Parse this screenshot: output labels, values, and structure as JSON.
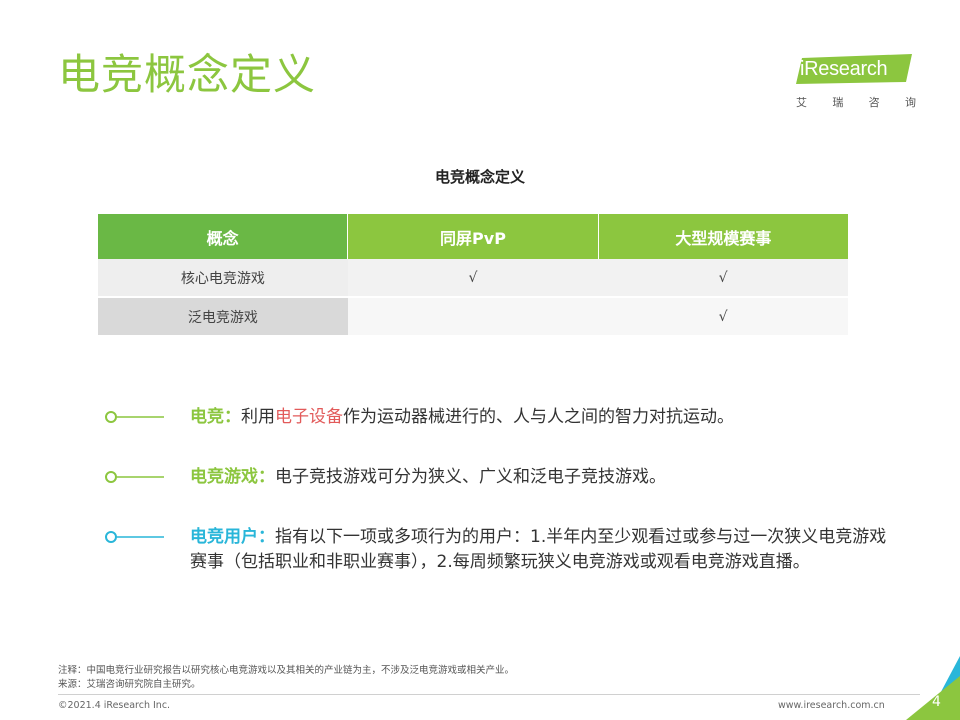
{
  "header": {
    "title": "电竞概念定义",
    "logo_text": "iResearch",
    "logo_sub": [
      "艾",
      "瑞",
      "咨",
      "询"
    ]
  },
  "table": {
    "title": "电竞概念定义",
    "headers": [
      "概念",
      "同屏PvP",
      "大型规模赛事"
    ],
    "rows": [
      [
        "核心电竞游戏",
        "√",
        "√"
      ],
      [
        "泛电竞游戏",
        "",
        "√"
      ]
    ]
  },
  "definitions": [
    {
      "term": "电竞",
      "colon": "：",
      "pre": "利用",
      "highlight": "电子设备",
      "post": "作为运动器械进行的、人与人之间的智力对抗运动。",
      "color": "#8cc63f"
    },
    {
      "term": "电竞游戏",
      "colon": "：",
      "pre": "电子竞技游戏可分为狭义、广义和泛电子竞技游戏。",
      "highlight": "",
      "post": "",
      "color": "#8cc63f"
    },
    {
      "term": "电竞用户",
      "colon": "：",
      "pre": "指有以下一项或多项行为的用户：1.半年内至少观看过或参与过一次狭义电竞游戏赛事（包括职业和非职业赛事），2.每周频繁玩狭义电竞游戏或观看电竞游戏直播。",
      "highlight": "",
      "post": "",
      "color": "#29b6d9"
    }
  ],
  "footer": {
    "note": "注释：中国电竞行业研究报告以研究核心电竞游戏以及其相关的产业链为主，不涉及泛电竞游戏或相关产业。",
    "source": "来源：艾瑞咨询研究院自主研究。",
    "copyright": "©2021.4 iResearch Inc.",
    "site": "www.iresearch.com.cn",
    "page": "4"
  },
  "colors": {
    "accent_green": "#8cc63f",
    "dark_green": "#6ab845",
    "accent_blue": "#29b6d9",
    "highlight_red": "#e25a5a"
  }
}
